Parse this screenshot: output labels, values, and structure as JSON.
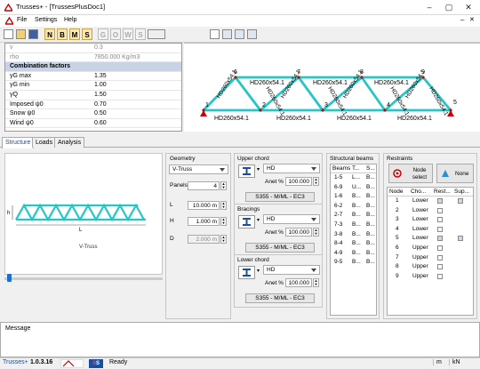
{
  "window": {
    "title": "Trusses+ - [TrussesPlusDoc1]",
    "minimize": "–",
    "restore": "▢",
    "close": "✕"
  },
  "menu": {
    "items": [
      "File",
      "Settings",
      "Help"
    ]
  },
  "toolbar": {
    "letters": [
      "N",
      "B",
      "M",
      "S",
      "G",
      "O",
      "W",
      "S"
    ]
  },
  "properties": {
    "rows": [
      {
        "k": "v",
        "v": "0.3",
        "type": "gray"
      },
      {
        "k": "rho",
        "v": "7850.000 Kg/m3",
        "type": "gray"
      },
      {
        "k": "Combination factors",
        "v": "",
        "type": "hdr"
      },
      {
        "k": "γG max",
        "v": "1.35",
        "type": ""
      },
      {
        "k": "γG min",
        "v": "1.00",
        "type": ""
      },
      {
        "k": "γQ",
        "v": "1.50",
        "type": ""
      },
      {
        "k": "Imposed ψ0",
        "v": "0.70",
        "type": ""
      },
      {
        "k": "Snow ψ0",
        "v": "0.50",
        "type": ""
      },
      {
        "k": "Wind ψ0",
        "v": "0.60",
        "type": ""
      }
    ]
  },
  "truss_view": {
    "top_labels": [
      "HD260x54.1",
      "HD260x54.1",
      "HD260x54.1"
    ],
    "bottom_labels": [
      "HD260x54.1",
      "HD260x54.1",
      "HD260x54.1",
      "HD260x54.1"
    ],
    "top_nodes": [
      "6",
      "7",
      "8",
      "9"
    ],
    "bottom_nodes": [
      "1",
      "2",
      "3",
      "4",
      "5"
    ],
    "diag_label": "HD260x54.1"
  },
  "tabs": [
    "Structure",
    "Loads",
    "Analysis"
  ],
  "preview": {
    "caption": "V-Truss",
    "dim_l": "L",
    "dim_h": "h"
  },
  "geometry": {
    "title": "Geometry",
    "type": "V-Truss",
    "panels_label": "Panels",
    "panels": "4",
    "L_label": "L",
    "L": "10.000 m",
    "H_label": "H",
    "H": "1.000 m",
    "D_label": "D",
    "D": "2.000 m"
  },
  "upper_chord": {
    "title": "Upper chord",
    "profile": "HD",
    "anet_label": "Anet %",
    "anet": "100.000",
    "material": "S355 - M/ML - EC3"
  },
  "bracings": {
    "title": "Bracings",
    "profile": "HD",
    "anet_label": "Anet %",
    "anet": "100.000",
    "material": "S355 - M/ML - EC3"
  },
  "lower_chord": {
    "title": "Lower chord",
    "profile": "HD",
    "anet_label": "Anet %",
    "anet": "100.000",
    "material": "S355 - M/ML - EC3"
  },
  "beams": {
    "title": "Structural beams",
    "headers": [
      "Beams",
      "T...",
      "S..."
    ],
    "rows": [
      [
        "1-5",
        "L...",
        "B..."
      ],
      [
        "6-9",
        "U...",
        "B..."
      ],
      [
        "1-6",
        "B...",
        "B..."
      ],
      [
        "6-2",
        "B...",
        "B..."
      ],
      [
        "2-7",
        "B...",
        "B..."
      ],
      [
        "7-3",
        "B...",
        "B..."
      ],
      [
        "3-8",
        "B...",
        "B..."
      ],
      [
        "8-4",
        "B...",
        "B..."
      ],
      [
        "4-9",
        "B...",
        "B..."
      ],
      [
        "9-5",
        "B...",
        "B..."
      ]
    ]
  },
  "restraints": {
    "title": "Restraints",
    "node_select": "Node select",
    "none": "None",
    "headers": [
      "Node",
      "Cho...",
      "Rest...",
      "Sup..."
    ],
    "rows": [
      {
        "node": "1",
        "chord": "Lower",
        "rest": true,
        "sup": true
      },
      {
        "node": "2",
        "chord": "Lower",
        "rest": false,
        "sup": false
      },
      {
        "node": "3",
        "chord": "Lower",
        "rest": false,
        "sup": false
      },
      {
        "node": "4",
        "chord": "Lower",
        "rest": false,
        "sup": false
      },
      {
        "node": "5",
        "chord": "Lower",
        "rest": true,
        "sup": true
      },
      {
        "node": "6",
        "chord": "Upper",
        "rest": false,
        "sup": false
      },
      {
        "node": "7",
        "chord": "Upper",
        "rest": false,
        "sup": false
      },
      {
        "node": "8",
        "chord": "Upper",
        "rest": false,
        "sup": false
      },
      {
        "node": "9",
        "chord": "Upper",
        "rest": false,
        "sup": false
      }
    ]
  },
  "message": {
    "label": "Message"
  },
  "status": {
    "app": "Trusses+",
    "version": "1.0.3.16",
    "state": "Ready",
    "unit_len": "m",
    "unit_force": "kN"
  },
  "colors": {
    "truss": "#26c6c6",
    "accent": "#1a4fa0",
    "status_red": "#c00000"
  }
}
